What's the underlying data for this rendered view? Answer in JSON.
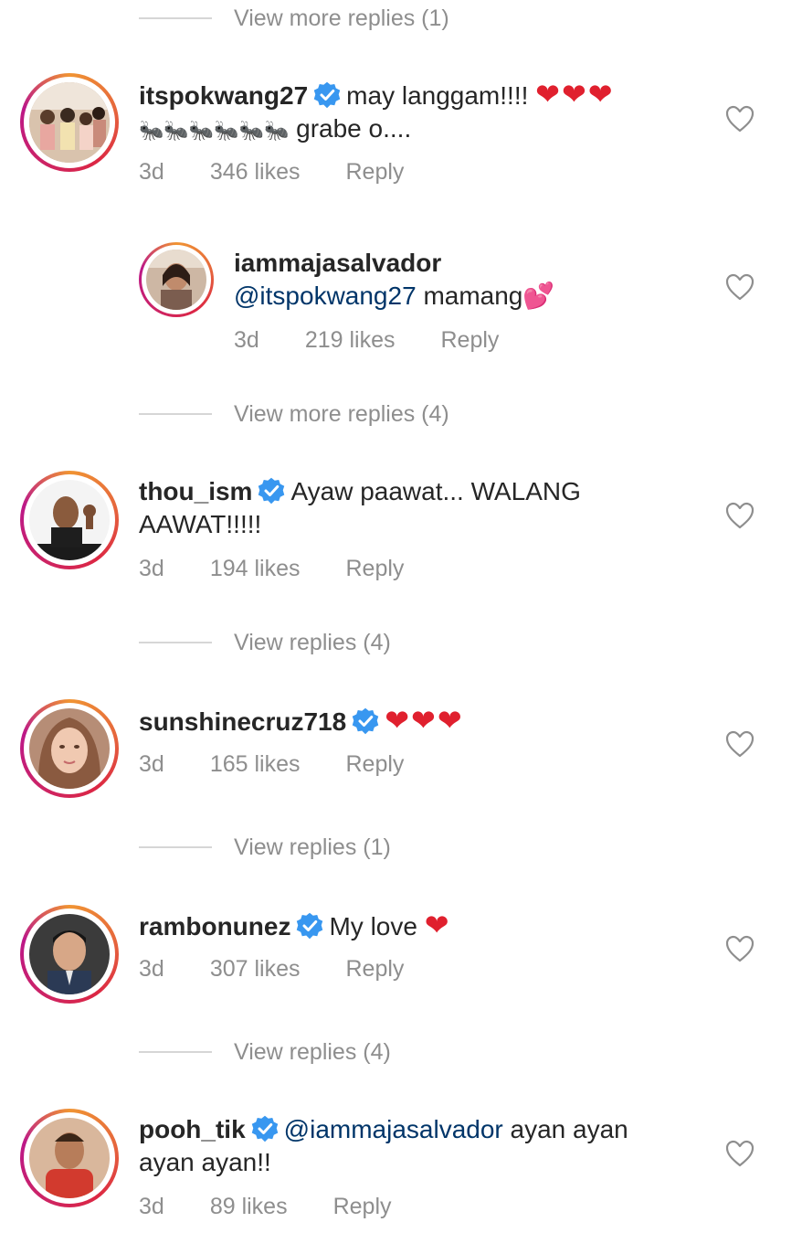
{
  "view_more_1": "View more replies (1)",
  "comments": [
    {
      "username": "itspokwang27",
      "text_line1": "may langgam!!!!",
      "hearts": "❤❤❤",
      "text_line2_ants": "🐜🐜🐜🐜🐜🐜",
      "text_line2": "grabe o....",
      "time": "3d",
      "likes": "346 likes",
      "reply": "Reply"
    },
    {
      "username": "iammajasalvador",
      "mention": "@itspokwang27",
      "text": "mamang",
      "emoji": "💕",
      "time": "3d",
      "likes": "219 likes",
      "reply": "Reply"
    },
    {
      "username": "thou_ism",
      "text_line1": "Ayaw paawat... WALANG",
      "text_line2": "AAWAT!!!!!",
      "time": "3d",
      "likes": "194 likes",
      "reply": "Reply"
    },
    {
      "username": "sunshinecruz718",
      "hearts": "❤❤❤",
      "time": "3d",
      "likes": "165 likes",
      "reply": "Reply"
    },
    {
      "username": "rambonunez",
      "text": "My love",
      "hearts": "❤",
      "time": "3d",
      "likes": "307 likes",
      "reply": "Reply"
    },
    {
      "username": "pooh_tik",
      "mention": "@iammajasalvador",
      "text_line1": "ayan ayan",
      "text_line2": "ayan ayan!!",
      "time": "3d",
      "likes": "89 likes",
      "reply": "Reply"
    }
  ],
  "view_more_2": "View more replies (4)",
  "view_replies_3": "View replies (4)",
  "view_replies_4": "View replies (1)",
  "view_replies_5": "View replies (4)",
  "icons": {
    "verified": "verified-badge-icon",
    "like": "heart-outline-icon"
  },
  "colors": {
    "verified_blue": "#3897f0",
    "mention_blue": "#003569",
    "meta_gray": "#8e8e8e",
    "heart_red": "#e0202e"
  }
}
